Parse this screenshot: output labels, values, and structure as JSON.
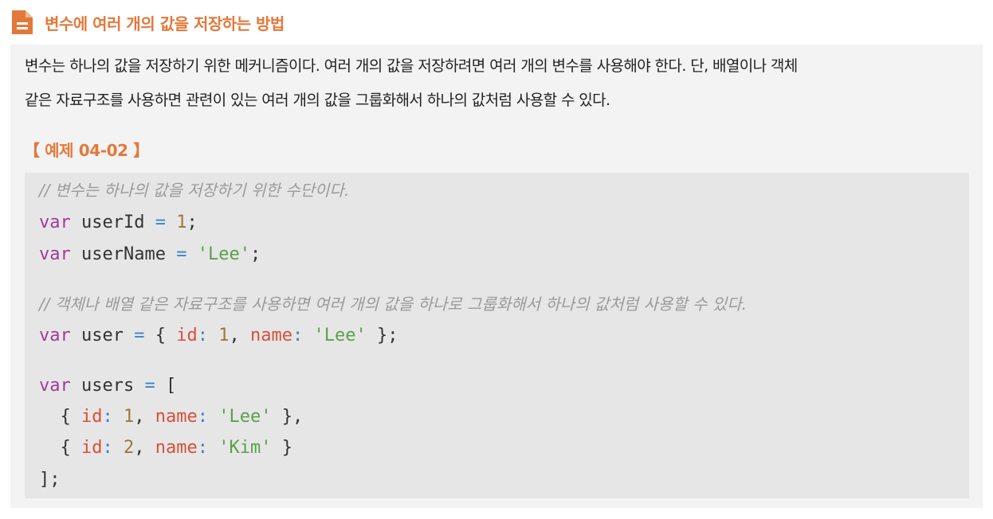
{
  "header": {
    "icon": "document-icon",
    "title": "변수에 여러 개의 값을 저장하는 방법",
    "accent_color": "#e2793b"
  },
  "paragraph": {
    "line1": "변수는 하나의 값을 저장하기 위한 메커니즘이다. 여러 개의 값을 저장하려면 여러 개의 변수를 사용해야 한다. 단, 배열이나 객체",
    "line2": "같은 자료구조를 사용하면 관련이 있는 여러 개의 값을 그룹화해서 하나의 값처럼 사용할 수 있다."
  },
  "example": {
    "title": "【 예제 04-02 】"
  },
  "code": {
    "comment1": "// 변수는 하나의 값을 저장하기 위한 수단이다.",
    "comment2": "// 객체나 배열 같은 자료구조를 사용하면 여러 개의 값을 하나로 그룹화해서 하나의 값처럼 사용할 수 있다.",
    "kw_var": "var",
    "op_eq": "=",
    "semi": ";",
    "colon": ":",
    "comma": ",",
    "brace_open": "{",
    "brace_close": "}",
    "brace_close_comma": "},",
    "brace_close_semi": "};",
    "bracket_open": "[",
    "bracket_close_semi": "];",
    "ident_userId": "userId",
    "ident_userName": "userName",
    "ident_user": "user",
    "ident_users": "users",
    "prop_id": "id",
    "prop_name": "name",
    "num_1": "1",
    "num_2": "2",
    "str_lee": "'Lee'",
    "str_kim": "'Kim'"
  }
}
